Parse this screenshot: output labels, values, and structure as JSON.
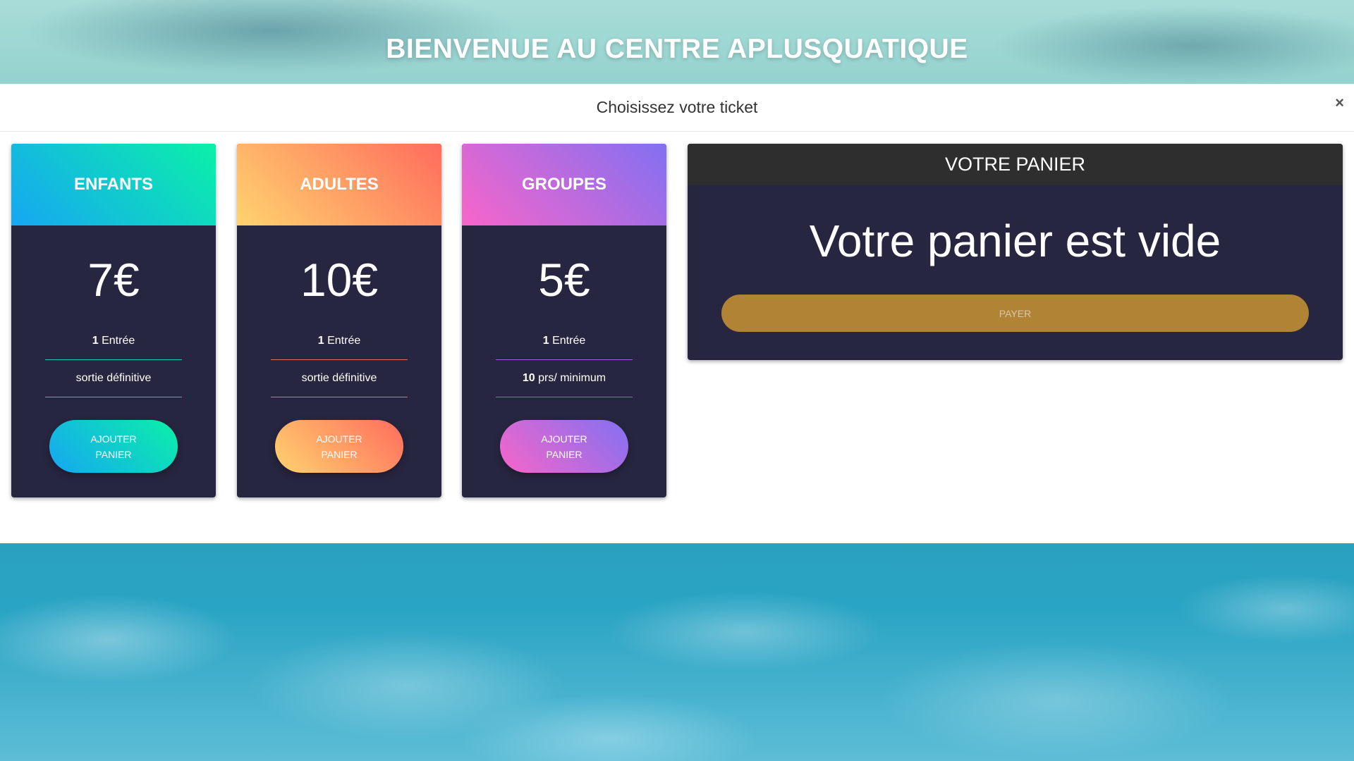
{
  "hero": {
    "title": "BIENVENUE AU CENTRE APLUSQUATIQUE"
  },
  "modal": {
    "title": "Choisissez votre ticket",
    "close_label": "×"
  },
  "tickets": [
    {
      "name": "ENFANTS",
      "price": "7€",
      "entry_count": "1",
      "entry_label": "Entrée",
      "detail_bold": "",
      "detail_text": "sortie définitive",
      "button_label_line1": "AJOUTER",
      "button_label_line2": "PANIER",
      "gradient": [
        "#16a6f2",
        "#0bf0a9"
      ]
    },
    {
      "name": "ADULTES",
      "price": "10€",
      "entry_count": "1",
      "entry_label": "Entrée",
      "detail_bold": "",
      "detail_text": "sortie définitive",
      "button_label_line1": "AJOUTER",
      "button_label_line2": "PANIER",
      "gradient": [
        "#ffd36e",
        "#ff6c5d"
      ]
    },
    {
      "name": "GROUPES",
      "price": "5€",
      "entry_count": "1",
      "entry_label": "Entrée",
      "detail_bold": "10",
      "detail_text": "prs/ minimum",
      "button_label_line1": "AJOUTER",
      "button_label_line2": "PANIER",
      "gradient": [
        "#f865c9",
        "#8270f2"
      ]
    }
  ],
  "cart": {
    "title": "VOTRE PANIER",
    "empty_message": "Votre panier est vide",
    "pay_label": "PAYER",
    "pay_color": "#b08335"
  }
}
